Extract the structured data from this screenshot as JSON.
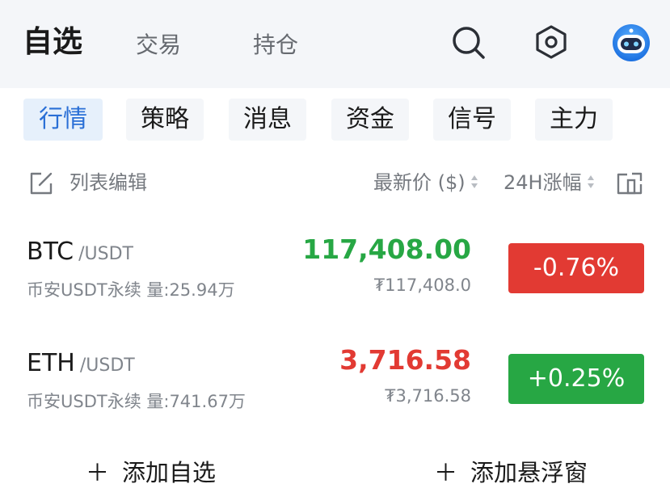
{
  "top_tabs": [
    "自选",
    "交易",
    "持仓"
  ],
  "sub_tabs": [
    "行情",
    "策略",
    "消息",
    "资金",
    "信号",
    "主力"
  ],
  "list_header": {
    "edit_label": "列表编辑",
    "price_col": "最新价 ($)",
    "change_col": "24H涨幅"
  },
  "rows": [
    {
      "base": "BTC",
      "quote": "/USDT",
      "subtitle": "币安USDT永续 量:25.94万",
      "price": "117,408.00",
      "price_cny": "₮117,408.0",
      "change": "-0.76%"
    },
    {
      "base": "ETH",
      "quote": "/USDT",
      "subtitle": "币安USDT永续 量:741.67万",
      "price": "3,716.58",
      "price_cny": "₮3,716.58",
      "change": "+0.25%"
    }
  ],
  "bottom_actions": [
    "添加自选",
    "添加悬浮窗"
  ],
  "colors": {
    "up_green": "#27a744",
    "down_red": "#e23a33",
    "accent_blue": "#2a6fd6"
  },
  "icons": [
    "search-icon",
    "settings-hex-icon",
    "robot-avatar-icon",
    "edit-icon",
    "sort-icon",
    "share-icon",
    "plus-icon"
  ]
}
